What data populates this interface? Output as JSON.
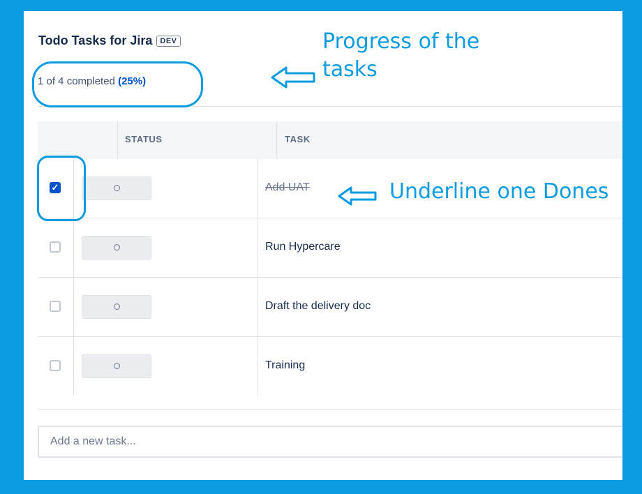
{
  "header": {
    "title": "Todo Tasks for Jira",
    "badge": "DEV",
    "progress_prefix": "1 of 4 completed",
    "progress_percent": "(25%)",
    "progress_fraction": 0.25
  },
  "table": {
    "columns": [
      "STATUS",
      "TASK"
    ],
    "rows": [
      {
        "checked": true,
        "task": "Add UAT"
      },
      {
        "checked": false,
        "task": "Run Hypercare"
      },
      {
        "checked": false,
        "task": "Draft the delivery doc"
      },
      {
        "checked": false,
        "task": "Training"
      }
    ]
  },
  "add_task": {
    "placeholder": "Add a new task...",
    "value": ""
  },
  "annotations": {
    "progress_note": "Progress of the tasks",
    "done_note": "Underline one Dones",
    "color": "#0a9be0"
  },
  "colors": {
    "background": "#0a9be0",
    "checkbox_checked": "#0052cc",
    "link": "#0052cc"
  }
}
